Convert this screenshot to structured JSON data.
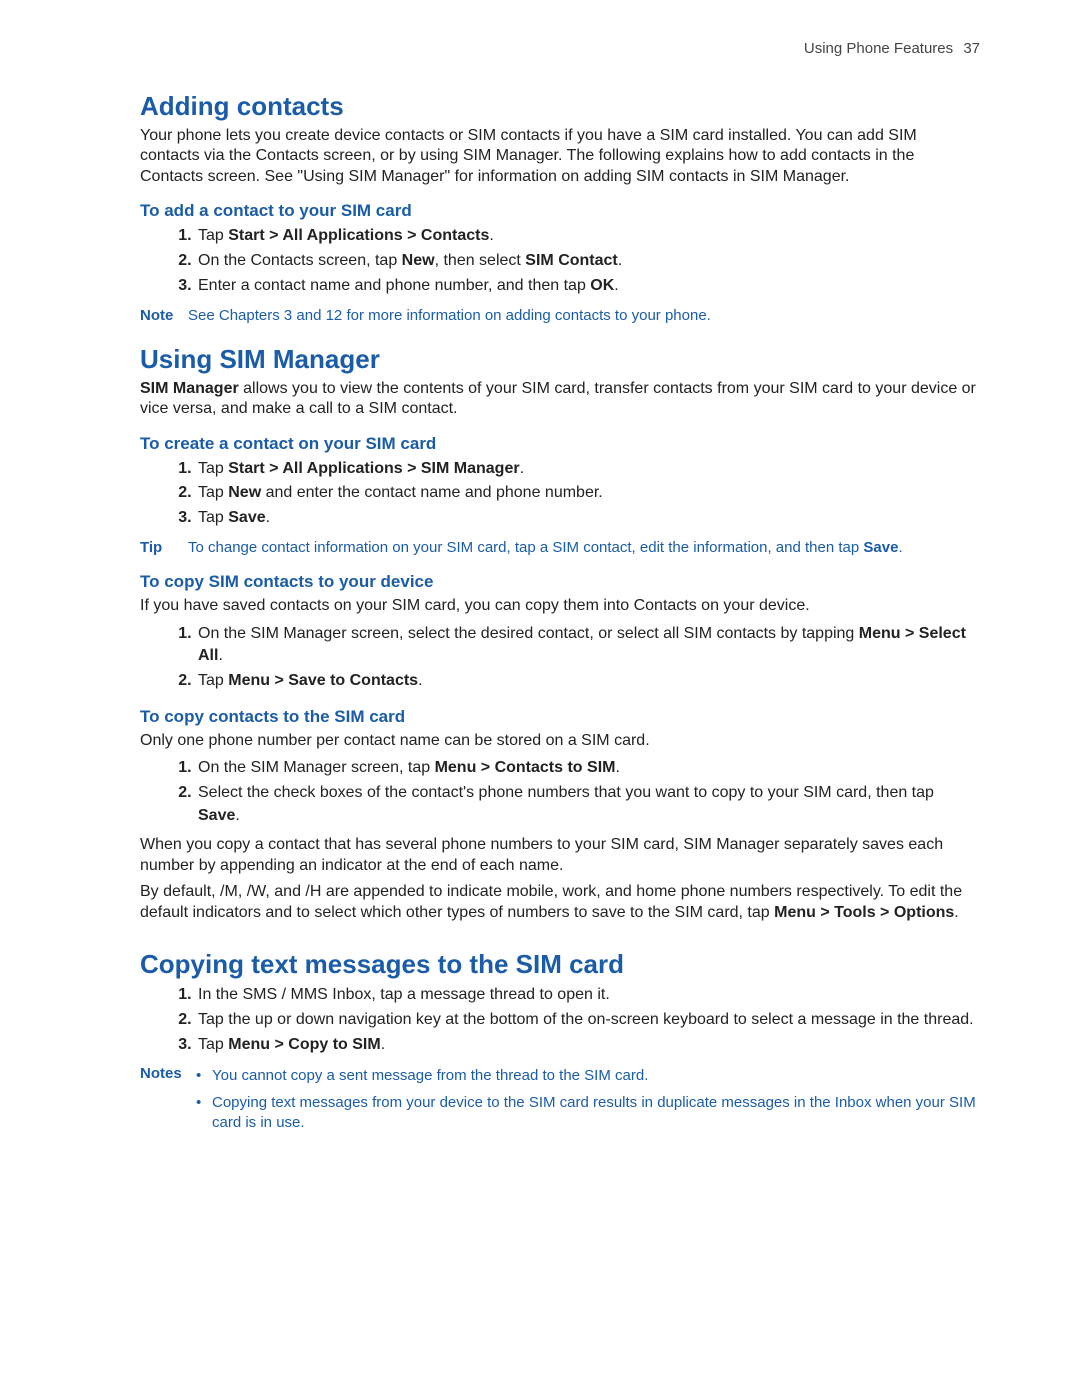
{
  "header": {
    "chapter": "Using Phone Features",
    "page": "37"
  },
  "s1": {
    "title": "Adding contacts",
    "intro": "Your phone lets you create device contacts or SIM contacts if you have a SIM card installed. You can add SIM contacts via the Contacts screen, or by using SIM Manager. The following explains how to add contacts in the Contacts screen. See \"Using SIM Manager\" for information on adding SIM contacts in SIM Manager.",
    "sub1": "To add a contact to your SIM card",
    "steps1": {
      "a_pre": "Tap ",
      "a_b": "Start > All Applications > Contacts",
      "a_post": ".",
      "b_pre": "On the Contacts screen, tap ",
      "b_b1": "New",
      "b_mid": ", then select ",
      "b_b2": "SIM Contact",
      "b_post": ".",
      "c_pre": "Enter a contact name and phone number, and then tap ",
      "c_b": "OK",
      "c_post": "."
    },
    "note_label": "Note",
    "note_text": "See Chapters 3 and 12 for more information on adding contacts to your phone."
  },
  "s2": {
    "title": "Using SIM Manager",
    "intro_b": "SIM Manager",
    "intro_post": " allows you to view the contents of your SIM card, transfer contacts from your SIM card to your device or vice versa, and make a call to a SIM contact.",
    "subA": "To create a contact on your SIM card",
    "stepsA": {
      "a_pre": "Tap ",
      "a_b": "Start > All Applications > SIM Manager",
      "a_post": ".",
      "b_pre": "Tap ",
      "b_b": "New",
      "b_post": " and enter the contact name and phone number.",
      "c_pre": "Tap ",
      "c_b": "Save",
      "c_post": "."
    },
    "tip_label": "Tip",
    "tip_pre": "To change contact information on your SIM card, tap a SIM contact, edit the information, and then tap ",
    "tip_b": "Save",
    "tip_post": ".",
    "subB": "To copy SIM contacts to your device",
    "bodyB": "If you have saved contacts on your SIM card, you can copy them into Contacts on your device.",
    "stepsB": {
      "a_pre": "On the SIM Manager screen, select the desired contact, or select all SIM contacts by tapping ",
      "a_b": "Menu > Select All",
      "a_post": ".",
      "b_pre": "Tap ",
      "b_b": "Menu > Save to Contacts",
      "b_post": "."
    },
    "subC": "To copy contacts to the SIM card",
    "bodyC": "Only one phone number per contact name can be stored on a SIM card.",
    "stepsC": {
      "a_pre": "On the SIM Manager screen, tap ",
      "a_b": "Menu > Contacts to SIM",
      "a_post": ".",
      "b_pre": "Select the check boxes of the contact's phone numbers that you want to copy to your SIM card, then tap ",
      "b_b": "Save",
      "b_post": "."
    },
    "paraAfter1": "When you copy a contact that has several phone numbers to your SIM card, SIM Manager separately saves each number by appending an indicator at the end of each name.",
    "paraAfter2_pre": "By default, /M, /W, and /H are appended to indicate mobile, work, and home phone numbers respectively. To edit the default indicators and to select which other types of numbers to save to the SIM card, tap ",
    "paraAfter2_b": "Menu > Tools > Options",
    "paraAfter2_post": "."
  },
  "s3": {
    "title": "Copying text messages to the SIM card",
    "steps": {
      "a": "In the SMS / MMS Inbox, tap a message thread to open it.",
      "b": "Tap the up or down navigation key at the bottom of the on-screen keyboard to select a message in the thread.",
      "c_pre": "Tap ",
      "c_b": "Menu > Copy to SIM",
      "c_post": "."
    },
    "notes_label": "Notes",
    "notes": {
      "a": "You cannot copy a sent message from the thread to the SIM card.",
      "b": "Copying text messages from your device to the SIM card results in duplicate messages in the Inbox when your SIM card is in use."
    }
  }
}
